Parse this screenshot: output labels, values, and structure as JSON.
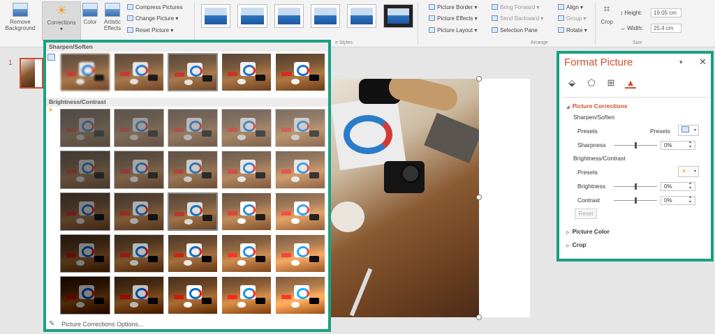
{
  "ribbon": {
    "remove_background": "Remove Background",
    "corrections": "Corrections",
    "color": "Color",
    "artistic_effects": "Artistic Effects",
    "compress_pictures": "Compress Pictures",
    "change_picture": "Change Picture",
    "reset_picture": "Reset Picture",
    "picture_styles_label": "e Styles",
    "picture_border": "Picture Border",
    "picture_effects": "Picture Effects",
    "picture_layout": "Picture Layout",
    "bring_forward": "Bring Forward",
    "send_backward": "Send Backward",
    "selection_pane": "Selection Pane",
    "align": "Align",
    "group": "Group",
    "rotate": "Rotate",
    "arrange_label": "Arrange",
    "crop": "Crop",
    "height_label": "Height:",
    "height_value": "19.05 cm",
    "width_label": "Width:",
    "width_value": "25.4 cm",
    "size_label": "Size"
  },
  "thumbs": {
    "slide_number": "1"
  },
  "gallery": {
    "sharpen_soften": "Sharpen/Soften",
    "brightness_contrast": "Brightness/Contrast",
    "options": "Picture Corrections Options...",
    "sharpen_count": 5,
    "brightness_rows": 5,
    "brightness_cols": 5,
    "selected_sharpen_index": 2,
    "selected_brightness_index": 12
  },
  "format_pane": {
    "title": "Format Picture",
    "section_title": "Picture Corrections",
    "sharpen_soften": "Sharpen/Soften",
    "presets_label": "Presets",
    "presets_label2": "Presets",
    "sharpness_label": "Sharpness",
    "sharpness_value": "0%",
    "brightness_contrast": "Brightness/Contrast",
    "presets_label3": "Presets",
    "brightness_label": "Brightness",
    "brightness_value": "0%",
    "contrast_label": "Contrast",
    "contrast_value": "0%",
    "reset": "Reset",
    "picture_color": "Picture Color",
    "crop": "Crop"
  },
  "colors": {
    "accent": "#d34f2e",
    "highlight_frame": "#1aa084"
  }
}
